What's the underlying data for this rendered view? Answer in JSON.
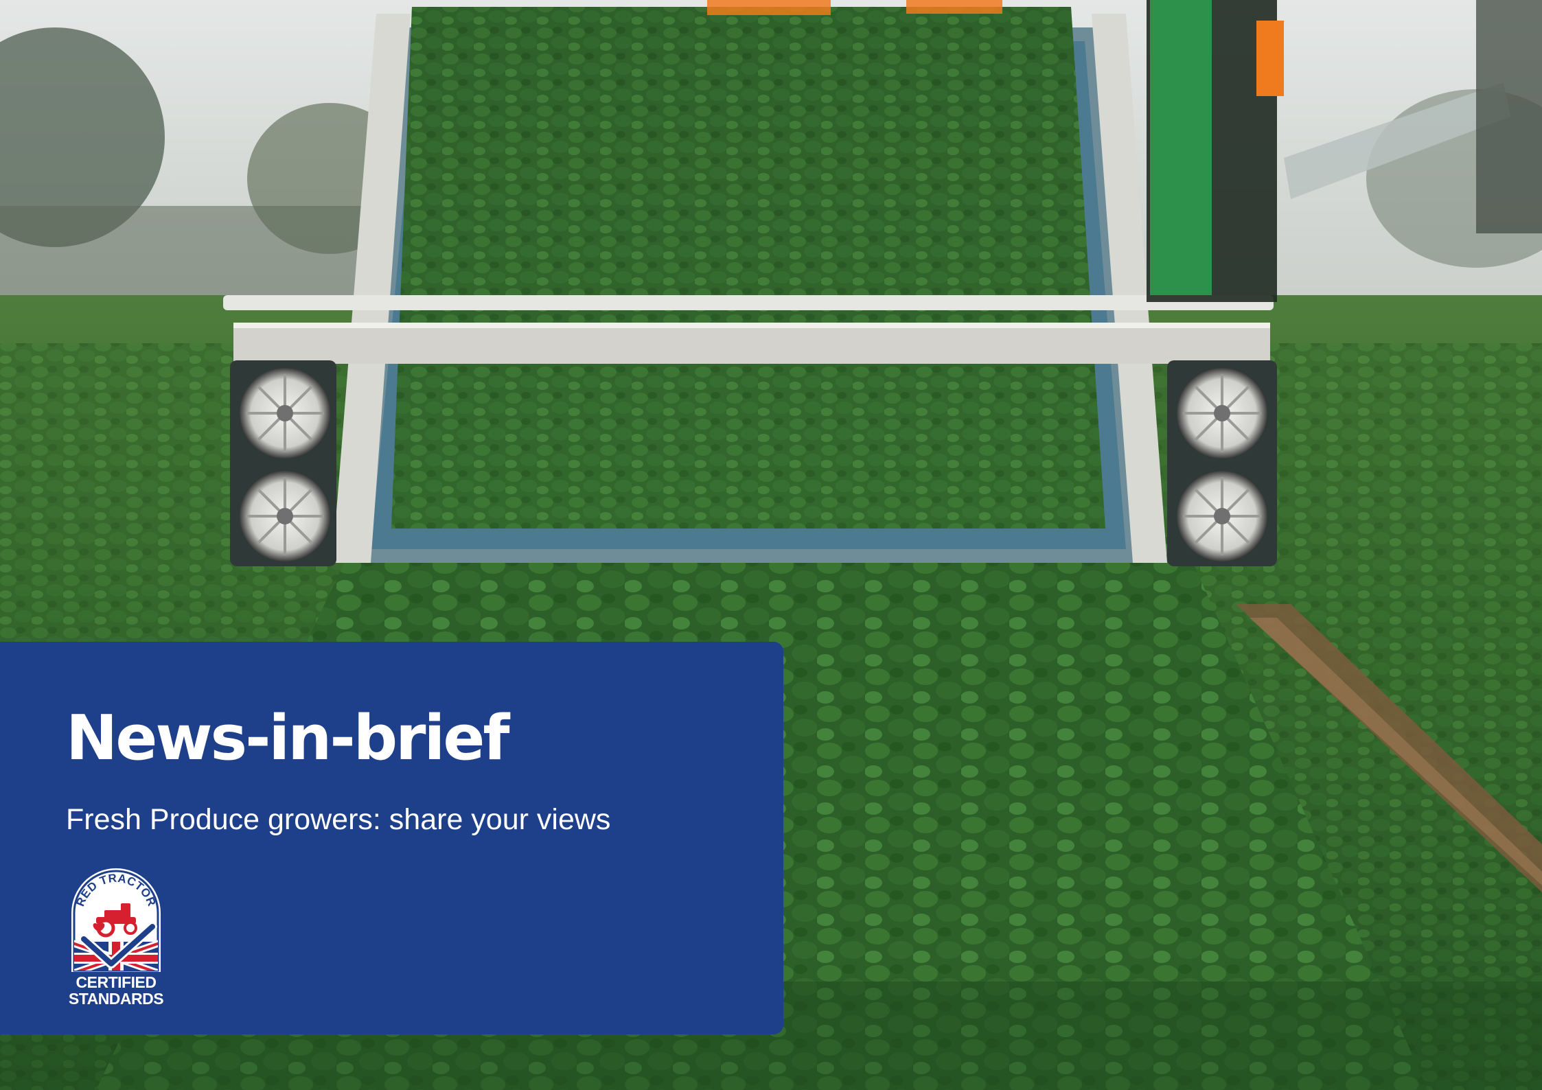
{
  "card": {
    "title": "News-in-brief",
    "subtitle": "Fresh Produce growers: share your views"
  },
  "logo": {
    "arc_text": "RED TRACTOR",
    "caption_line1": "CERTIFIED",
    "caption_line2": "STANDARDS"
  },
  "colors": {
    "card_background": "#1e3f8a",
    "text": "#ffffff",
    "logo_red": "#d6202f",
    "logo_blue": "#1e3f8a"
  }
}
